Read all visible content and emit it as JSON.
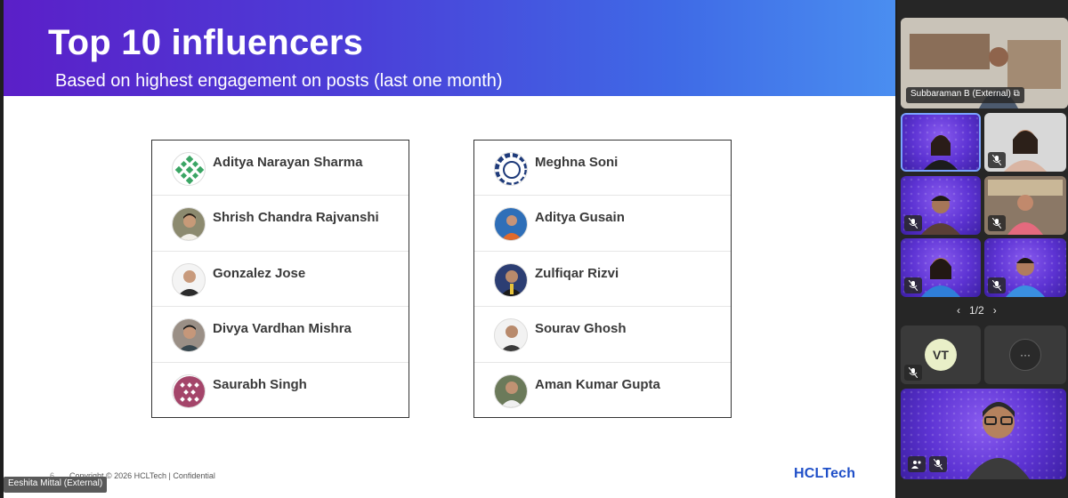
{
  "slide": {
    "title": "Top 10 influencers",
    "subtitle": "Based on highest engagement on posts (last one month)",
    "page_number": "6",
    "copyright": "Copyright © 2026 HCLTech | Confidential",
    "logo_text": "HCLTech",
    "left_list": [
      {
        "name": "Aditya Narayan Sharma",
        "avatar": "pattern-green-icon"
      },
      {
        "name": "Shrish Chandra Rajvanshi",
        "avatar": "person-photo"
      },
      {
        "name": "Gonzalez Jose",
        "avatar": "person-photo"
      },
      {
        "name": "Divya Vardhan Mishra",
        "avatar": "person-photo"
      },
      {
        "name": "Saurabh Singh",
        "avatar": "pattern-maroon-icon"
      }
    ],
    "right_list": [
      {
        "name": "Meghna Soni",
        "avatar": "pattern-blue-icon"
      },
      {
        "name": "Aditya Gusain",
        "avatar": "person-photo"
      },
      {
        "name": "Zulfiqar Rizvi",
        "avatar": "person-photo"
      },
      {
        "name": "Sourav Ghosh",
        "avatar": "person-photo"
      },
      {
        "name": "Aman Kumar Gupta",
        "avatar": "person-photo"
      }
    ]
  },
  "presenter_label": "Eeshita Mittal (External)",
  "sidebar": {
    "top_participant": "Subbaraman B (External)",
    "pager": "1/2",
    "avatar_initials": "VT",
    "more_label": "···"
  },
  "colors": {
    "banner_start": "#5b1fc8",
    "banner_end": "#4a8ef0",
    "tile_purple": "#5d33d3",
    "logo_blue": "#1f4fc8"
  }
}
